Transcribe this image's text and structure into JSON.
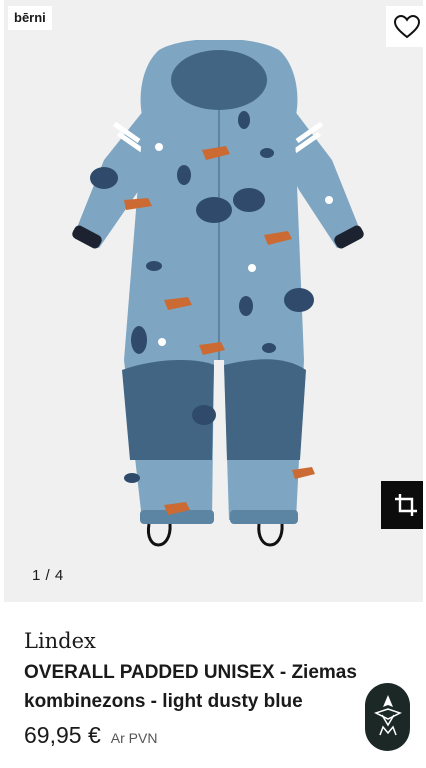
{
  "gallery": {
    "badge": "bērni",
    "counter": "1 / 4",
    "image_alt": "OVERALL PADDED UNISEX - Ziemas kombinezons - light dusty blue"
  },
  "icons": {
    "favorite": "heart-icon",
    "crop": "crop-icon",
    "assistant": "assistant-logo-icon"
  },
  "product": {
    "brand": "Lindex",
    "title": "OVERALL PADDED UNISEX - Ziemas kombinezons - light dusty blue",
    "price": "69,95 €",
    "vat_note": "Ar PVN"
  },
  "colors": {
    "suit_main": "#7ea6c2",
    "suit_dark": "#426584",
    "accent": "#0c0c0c"
  }
}
